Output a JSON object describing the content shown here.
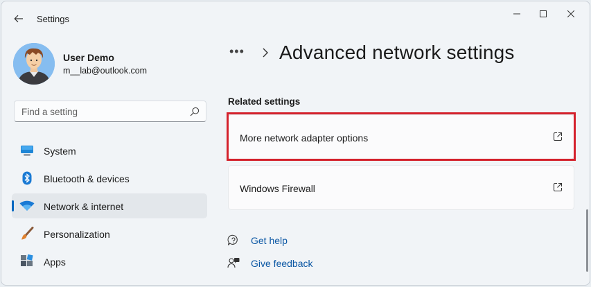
{
  "window": {
    "title": "Settings"
  },
  "profile": {
    "name": "User Demo",
    "email": "m__lab@outlook.com"
  },
  "search": {
    "placeholder": "Find a setting"
  },
  "nav": [
    {
      "label": "System",
      "icon": "monitor-icon",
      "active": false
    },
    {
      "label": "Bluetooth & devices",
      "icon": "bluetooth-icon",
      "active": false
    },
    {
      "label": "Network & internet",
      "icon": "wifi-icon",
      "active": true
    },
    {
      "label": "Personalization",
      "icon": "brush-icon",
      "active": false
    },
    {
      "label": "Apps",
      "icon": "apps-icon",
      "active": false
    }
  ],
  "main": {
    "breadcrumb_more": "•••",
    "page_title": "Advanced network settings",
    "section_title": "Related settings",
    "cards": [
      {
        "label": "More network adapter options",
        "icon": "external-link-icon",
        "highlighted": true
      },
      {
        "label": "Windows Firewall",
        "icon": "external-link-icon",
        "highlighted": false
      }
    ],
    "help_links": [
      {
        "label": "Get help",
        "icon": "help-icon"
      },
      {
        "label": "Give feedback",
        "icon": "feedback-icon"
      }
    ]
  },
  "colors": {
    "accent": "#0067c0",
    "highlight": "#d4212c",
    "link": "#0b57a4"
  }
}
